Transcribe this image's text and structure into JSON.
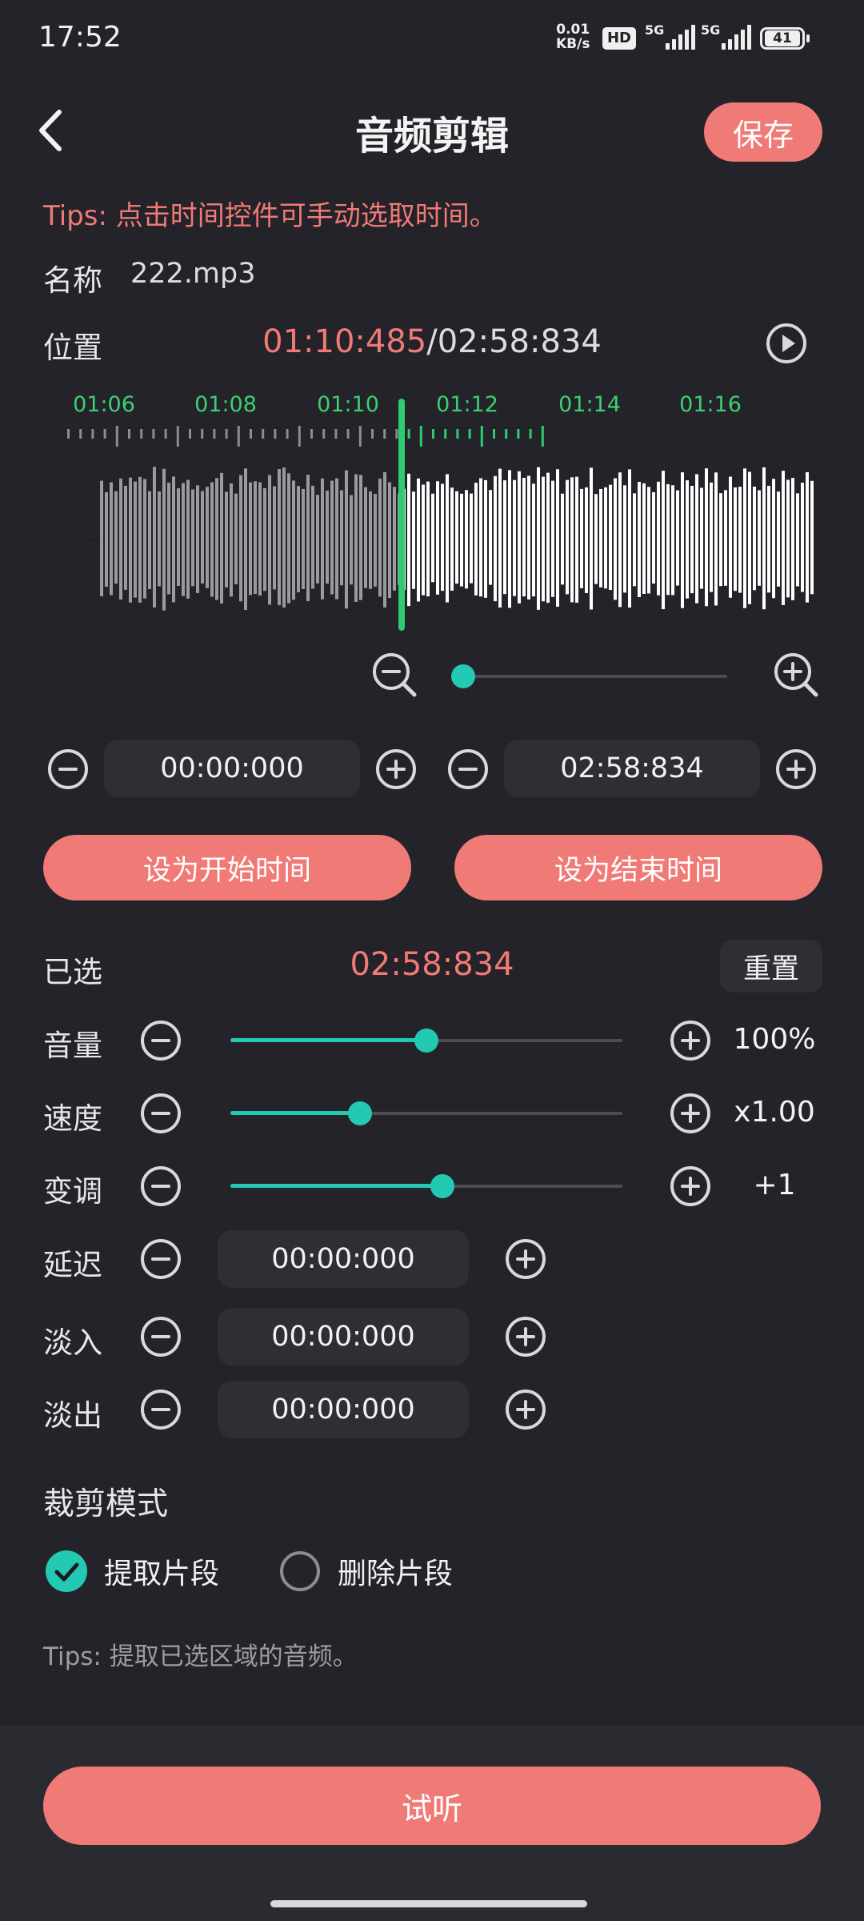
{
  "status_bar": {
    "time": "17:52",
    "net_speed_top": "0.01",
    "net_speed_bottom": "KB/s",
    "hd_badge": "HD",
    "sig1": "5G",
    "sig2": "5G",
    "battery": "41"
  },
  "header": {
    "title": "音频剪辑",
    "save_label": "保存"
  },
  "tips_top": "Tips: 点击时间控件可手动选取时间。",
  "name": {
    "label": "名称",
    "value": "222.mp3"
  },
  "position": {
    "label": "位置",
    "current": "01:10:485",
    "separator": "/",
    "total": "02:58:834"
  },
  "waveform": {
    "ticks": [
      "01:06",
      "01:08",
      "01:10",
      "01:12",
      "01:14",
      "01:16"
    ],
    "playhead_fraction": 0.455,
    "zoom_level": 0.0
  },
  "range": {
    "start": "00:00:000",
    "end": "02:58:834",
    "set_start_label": "设为开始时间",
    "set_end_label": "设为结束时间"
  },
  "selected": {
    "label": "已选",
    "value": "02:58:834",
    "reset_label": "重置"
  },
  "adjust": {
    "volume": {
      "label": "音量",
      "value": "100%",
      "level": 0.5
    },
    "speed": {
      "label": "速度",
      "value": "x1.00",
      "level": 0.33
    },
    "pitch": {
      "label": "变调",
      "value": "+1",
      "level": 0.54
    }
  },
  "timing": {
    "delay": {
      "label": "延迟",
      "value": "00:00:000"
    },
    "fade_in": {
      "label": "淡入",
      "value": "00:00:000"
    },
    "fade_out": {
      "label": "淡出",
      "value": "00:00:000"
    }
  },
  "crop_mode": {
    "title": "裁剪模式",
    "options": [
      {
        "label": "提取片段",
        "checked": true
      },
      {
        "label": "删除片段",
        "checked": false
      }
    ],
    "tips": "Tips: 提取已选区域的音频。"
  },
  "preview_label": "试听",
  "colors": {
    "accent": "#f07a76",
    "teal": "#23c9b3",
    "green": "#2ecc71",
    "bg": "#232329"
  }
}
